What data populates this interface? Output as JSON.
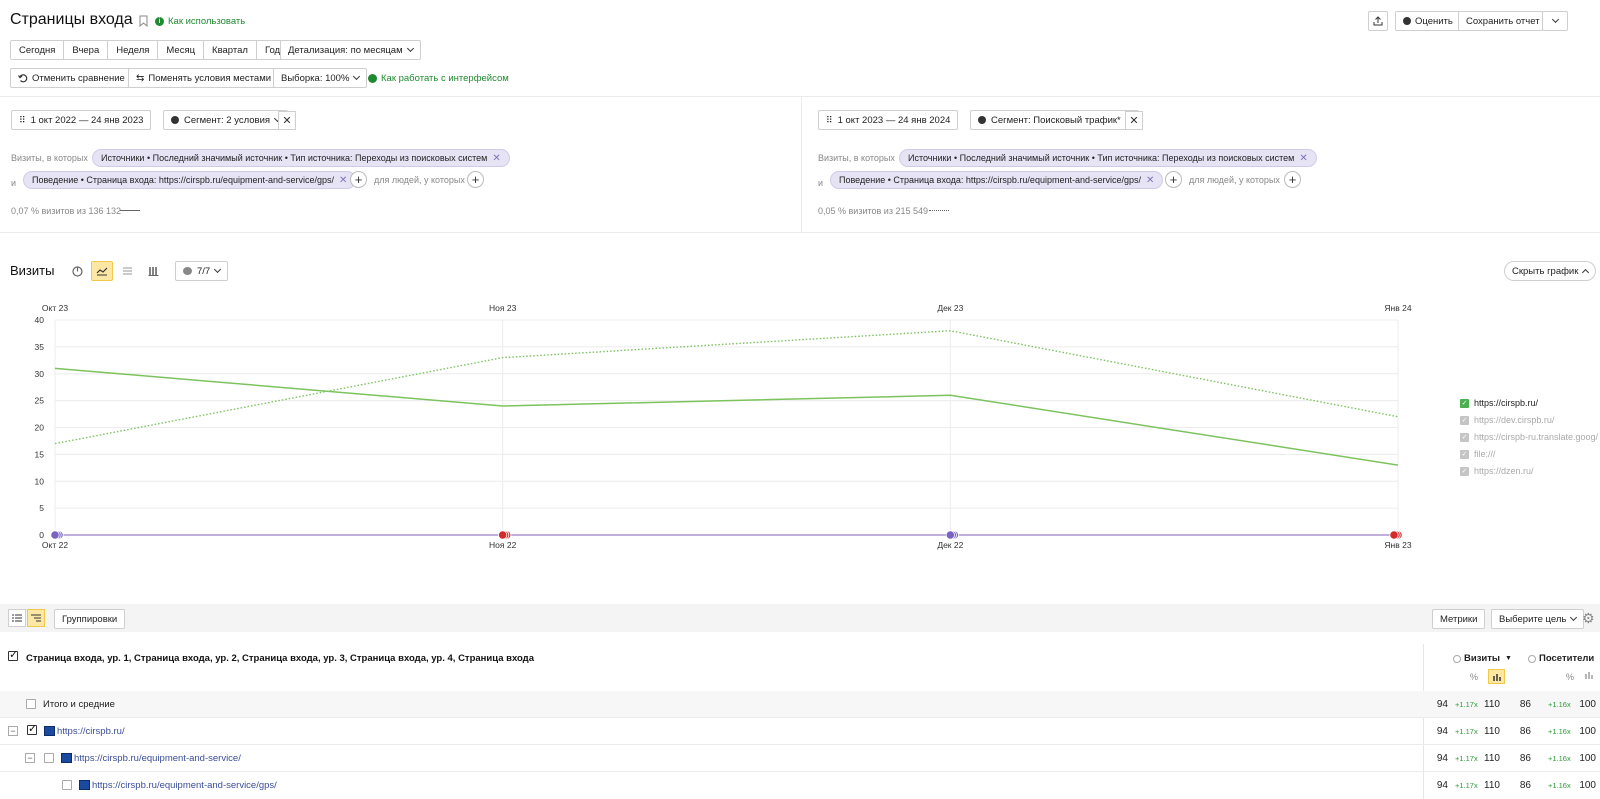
{
  "header": {
    "title": "Страницы входа",
    "how_to_use": "Как использовать",
    "rate": "Оценить",
    "save_report": "Сохранить отчет"
  },
  "periods": [
    "Сегодня",
    "Вчера",
    "Неделя",
    "Месяц",
    "Квартал",
    "Год"
  ],
  "detail": "Детализация: по месяцам",
  "toolbar2": {
    "cancel_compare": "Отменить сравнение",
    "swap": "Поменять условия местами",
    "sample": "Выборка: 100%",
    "how_work": "Как работать с интерфейсом"
  },
  "left_segment": {
    "date": "1 окт 2022 — 24 янв 2023",
    "segment": "Сегмент: 2 условия",
    "visits_where": "Визиты, в которых",
    "tag1": "Источники • Последний значимый источник • Тип источника: Переходы из поисковых систем",
    "and": "и",
    "tag2": "Поведение • Страница входа: https://cirspb.ru/equipment-and-service/gps/",
    "for_people": "для людей, у которых",
    "summary": "0,07 % визитов из 136 132"
  },
  "right_segment": {
    "date": "1 окт 2023 — 24 янв 2024",
    "segment": "Сегмент: Поисковый трафик*",
    "visits_where": "Визиты, в которых",
    "tag1": "Источники • Последний значимый источник • Тип источника: Переходы из поисковых систем",
    "and": "и",
    "tag2": "Поведение • Страница входа: https://cirspb.ru/equipment-and-service/gps/",
    "for_people": "для людей, у которых",
    "summary": "0,05 % визитов из 215 549"
  },
  "chart_section": {
    "title": "Визиты",
    "series_count": "7/7",
    "hide_chart": "Скрыть график"
  },
  "chart_data": {
    "type": "line",
    "x_top": [
      "Окт 23",
      "Ноя 23",
      "Дек 23",
      "Янв 24"
    ],
    "x_bottom": [
      "Окт 22",
      "Ноя 22",
      "Дек 22",
      "Янв 23"
    ],
    "y_ticks": [
      "40",
      "35",
      "30",
      "25",
      "20",
      "15",
      "10",
      "5",
      "0"
    ],
    "ylim": [
      0,
      40
    ],
    "series": [
      {
        "name": "https://cirspb.ru/",
        "period": "current",
        "style": "solid",
        "color": "#7cc35d",
        "values": [
          31,
          24,
          26,
          13
        ]
      },
      {
        "name": "https://cirspb.ru/",
        "period": "compare",
        "style": "dotted",
        "color": "#7cc35d",
        "values": [
          17,
          33,
          38,
          22
        ]
      }
    ],
    "legend": [
      {
        "label": "https://cirspb.ru/",
        "active": true
      },
      {
        "label": "https://dev.cirspb.ru/",
        "active": false
      },
      {
        "label": "https://cirspb-ru.translate.goog/",
        "active": false
      },
      {
        "label": "file:///",
        "active": false
      },
      {
        "label": "https://dzen.ru/",
        "active": false
      }
    ],
    "grid": true,
    "legend_position": "right"
  },
  "table": {
    "groupings_btn": "Группировки",
    "metrics_btn": "Метрики",
    "goal_btn": "Выберите цель",
    "header_dims": "Страница входа, ур. 1, Страница входа, ур. 2, Страница входа, ур. 3, Страница входа, ур. 4, Страница входа",
    "col_visits": "Визиты",
    "col_visitors": "Посетители",
    "rows": [
      {
        "label": "Итого и средние",
        "v1": "94",
        "d1": "+1.17x",
        "v2": "110",
        "u1": "86",
        "d2": "+1.16x",
        "u2": "100"
      },
      {
        "label": "https://cirspb.ru/",
        "v1": "94",
        "d1": "+1.17x",
        "v2": "110",
        "u1": "86",
        "d2": "+1.16x",
        "u2": "100"
      },
      {
        "label": "https://cirspb.ru/equipment-and-service/",
        "v1": "94",
        "d1": "+1.17x",
        "v2": "110",
        "u1": "86",
        "d2": "+1.16x",
        "u2": "100"
      },
      {
        "label": "https://cirspb.ru/equipment-and-service/gps/",
        "v1": "94",
        "d1": "+1.17x",
        "v2": "110",
        "u1": "86",
        "d2": "+1.16x",
        "u2": "100"
      }
    ]
  }
}
